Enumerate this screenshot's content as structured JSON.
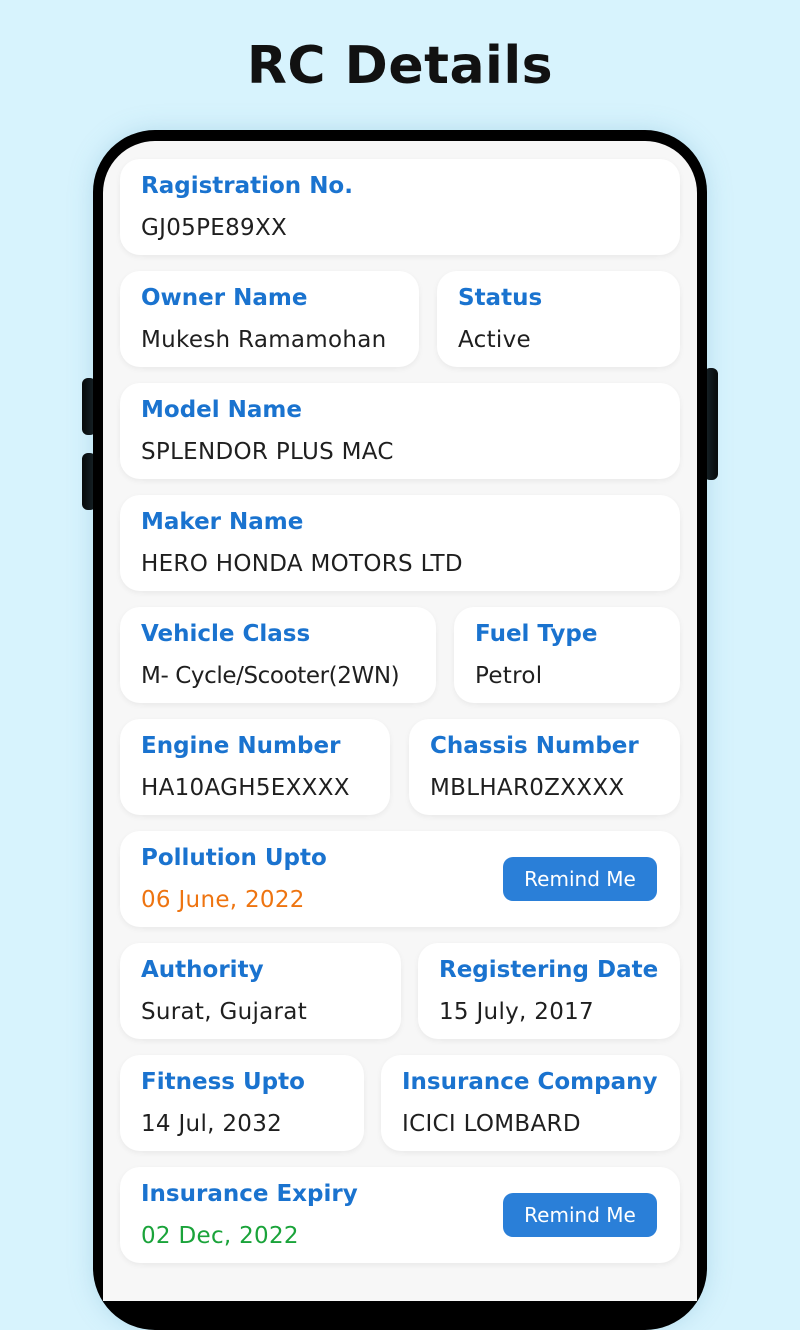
{
  "page": {
    "title": "RC Details"
  },
  "colors": {
    "background": "#d7f3fd",
    "label": "#1a73cf",
    "value": "#1f1f1f",
    "pollution_date": "#ee7410",
    "insurance_date": "#1aa33a",
    "button": "#2a7fd8"
  },
  "fields": {
    "registration": {
      "label": "Ragistration No.",
      "value": "GJ05PE89XX"
    },
    "owner": {
      "label": "Owner Name",
      "value": "Mukesh Ramamohan"
    },
    "status": {
      "label": "Status",
      "value": "Active"
    },
    "model": {
      "label": "Model Name",
      "value": "SPLENDOR PLUS MAC"
    },
    "maker": {
      "label": "Maker Name",
      "value": "HERO HONDA MOTORS LTD"
    },
    "vehicle_class": {
      "label": "Vehicle Class",
      "value": "M- Cycle/Scooter(2WN)"
    },
    "fuel_type": {
      "label": "Fuel Type",
      "value": "Petrol"
    },
    "engine": {
      "label": "Engine Number",
      "value": "HA10AGH5EXXXX"
    },
    "chassis": {
      "label": "Chassis Number",
      "value": "MBLHAR0ZXXXX"
    },
    "pollution": {
      "label": "Pollution Upto",
      "value": "06 June, 2022",
      "button": "Remind Me"
    },
    "authority": {
      "label": "Authority",
      "value": "Surat, Gujarat"
    },
    "registering_date": {
      "label": "Registering Date",
      "value": "15 July, 2017"
    },
    "fitness": {
      "label": "Fitness Upto",
      "value": "14 Jul, 2032"
    },
    "insurance_company": {
      "label": "Insurance Company",
      "value": "ICICI LOMBARD"
    },
    "insurance_expiry": {
      "label": "Insurance Expiry",
      "value": "02 Dec, 2022",
      "button": "Remind Me"
    }
  }
}
